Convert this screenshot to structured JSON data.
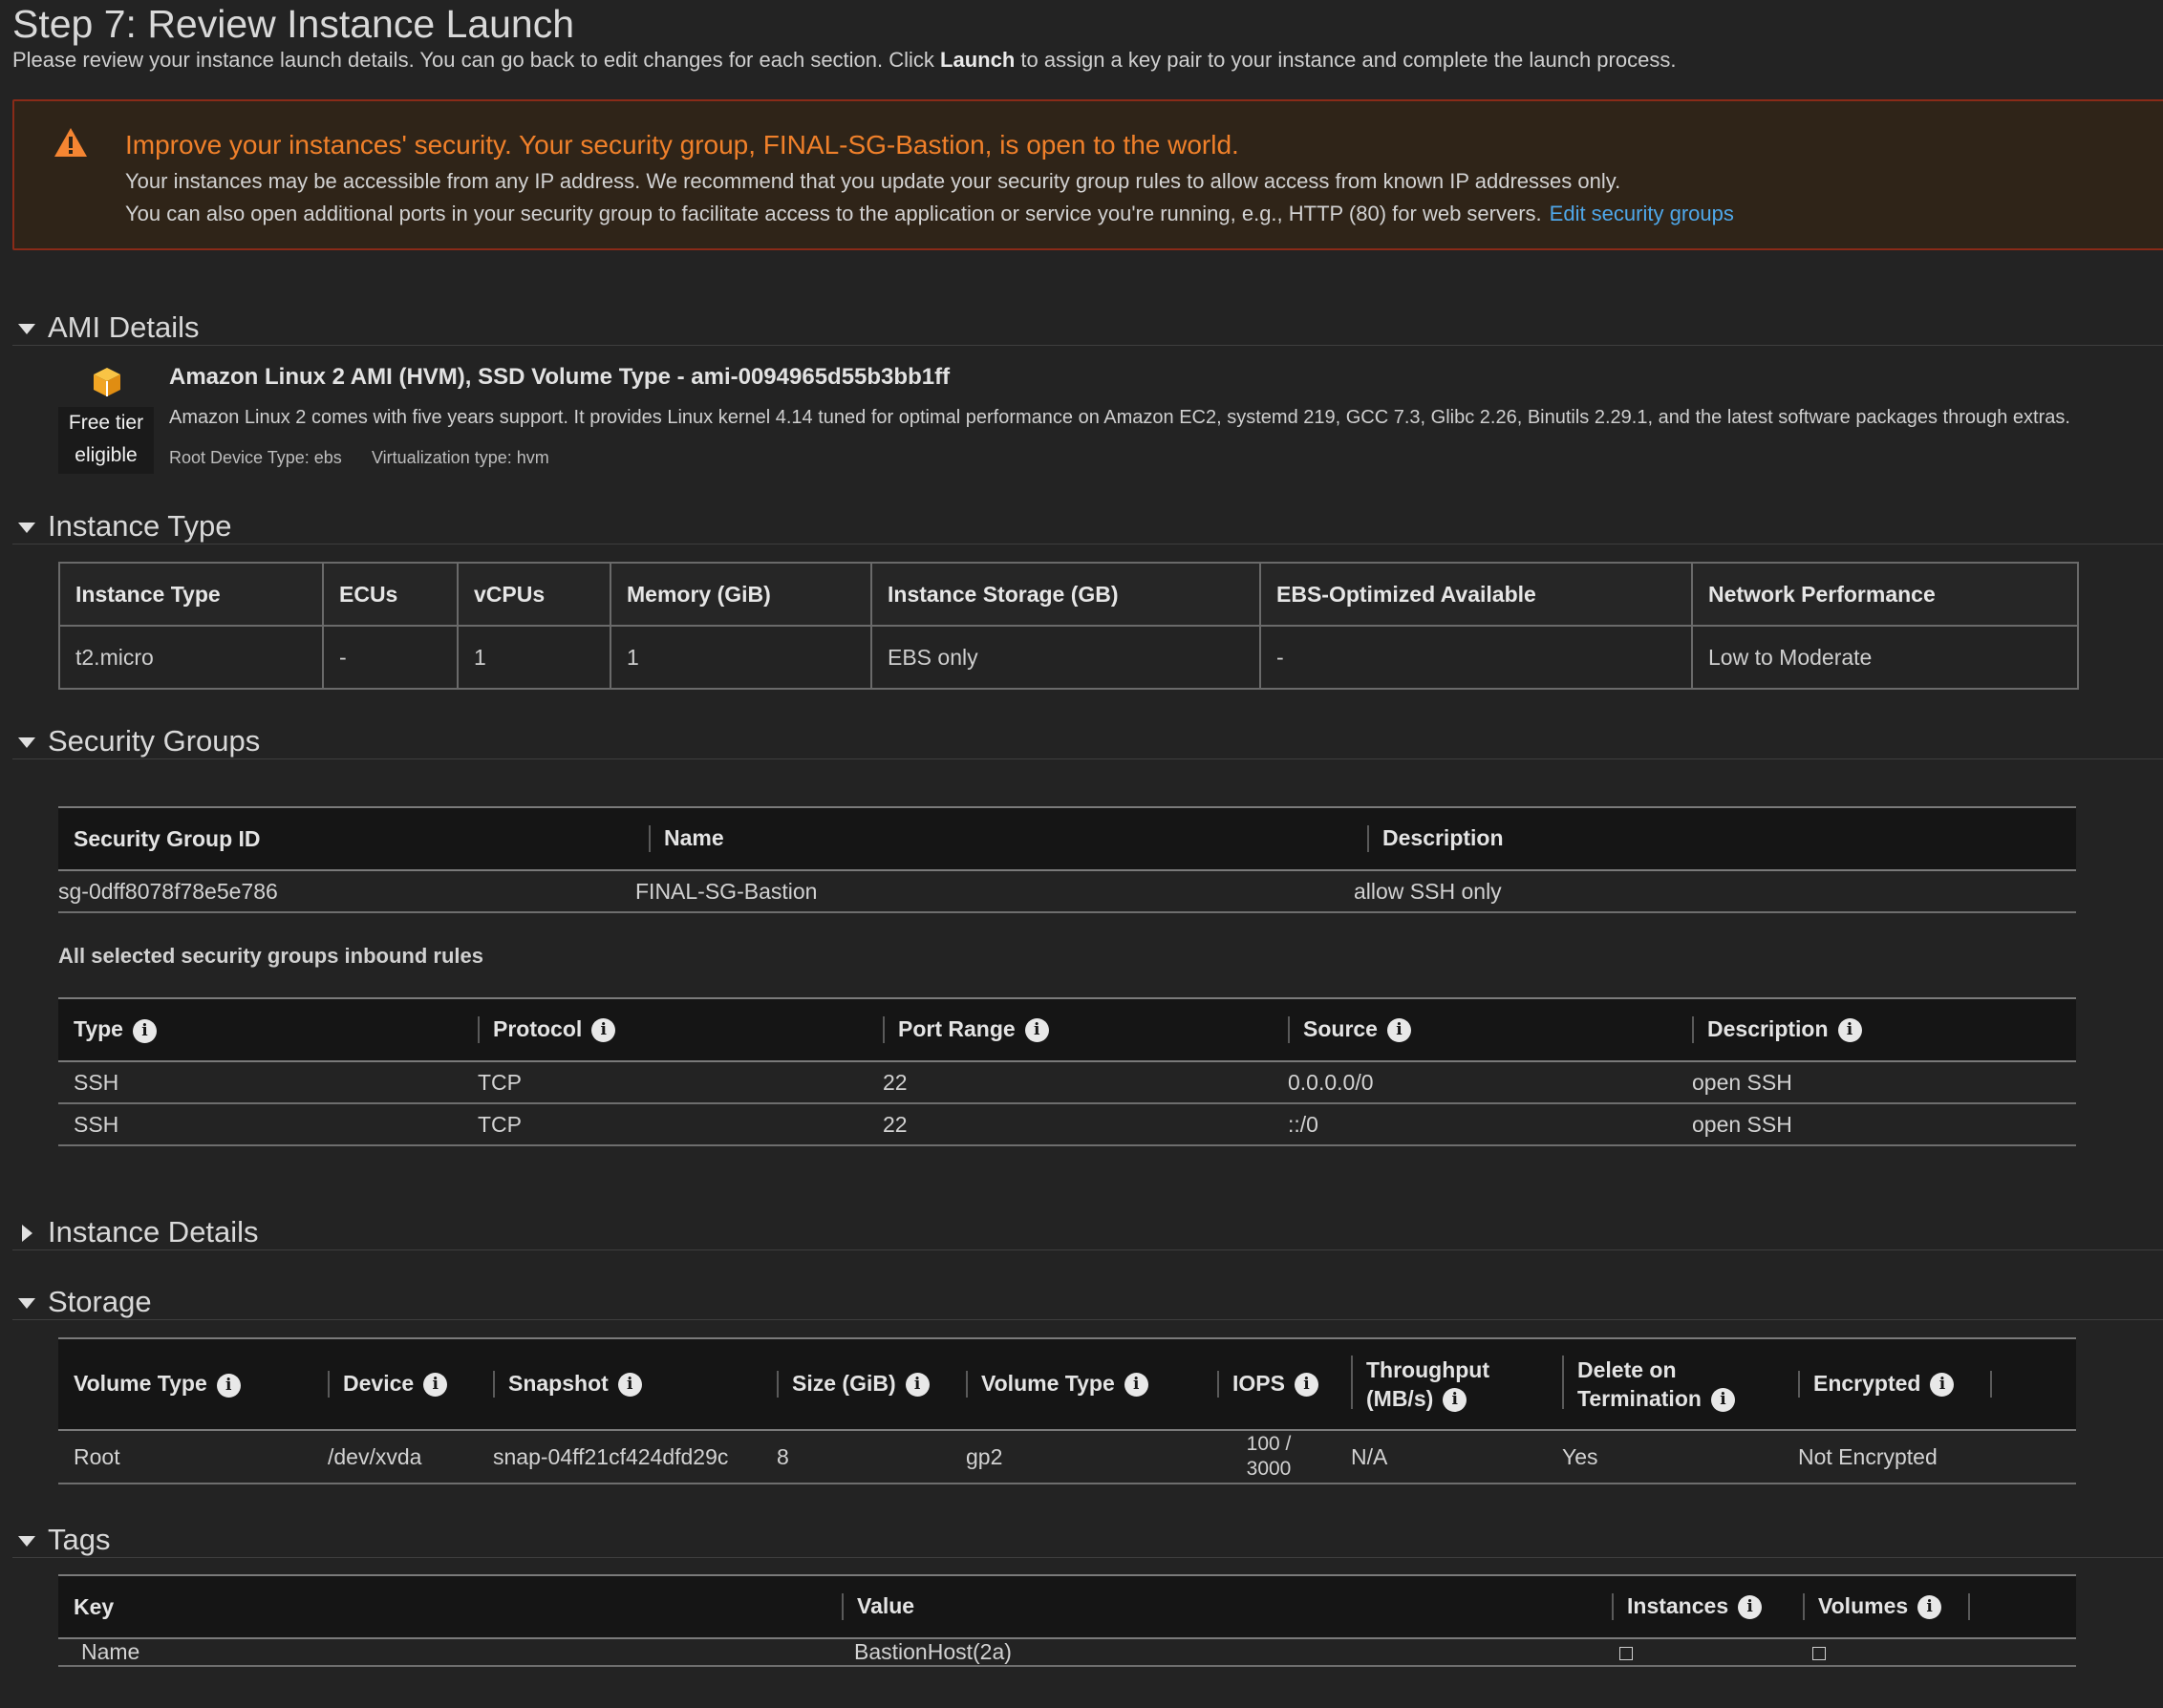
{
  "header": {
    "title": "Step 7: Review Instance Launch",
    "subtitle_pre": "Please review your instance launch details. You can go back to edit changes for each section. Click ",
    "subtitle_bold": "Launch",
    "subtitle_post": " to assign a key pair to your instance and complete the launch process."
  },
  "warning": {
    "title": "Improve your instances' security. Your security group, FINAL-SG-Bastion, is open to the world.",
    "line1": "Your instances may be accessible from any IP address. We recommend that you update your security group rules to allow access from known IP addresses only.",
    "line2": "You can also open additional ports in your security group to facilitate access to the application or service you're running, e.g., HTTP (80) for web servers.",
    "link": "Edit security groups",
    "icon": "warning-triangle-icon",
    "accent": "#f0802a"
  },
  "ami": {
    "section_label": "AMI Details",
    "badge_line1": "Free tier",
    "badge_line2": "eligible",
    "title": "Amazon Linux 2 AMI (HVM), SSD Volume Type - ami-0094965d55b3bb1ff",
    "description": "Amazon Linux 2 comes with five years support. It provides Linux kernel 4.14 tuned for optimal performance on Amazon EC2, systemd 219, GCC 7.3, Glibc 2.26, Binutils 2.29.1, and the latest software packages through extras.",
    "root_device": "Root Device Type: ebs",
    "virtualization": "Virtualization type: hvm"
  },
  "instance_type": {
    "section_label": "Instance Type",
    "headers": [
      "Instance Type",
      "ECUs",
      "vCPUs",
      "Memory (GiB)",
      "Instance Storage (GB)",
      "EBS-Optimized Available",
      "Network Performance"
    ],
    "row": [
      "t2.micro",
      "-",
      "1",
      "1",
      "EBS only",
      "-",
      "Low to Moderate"
    ]
  },
  "security_groups": {
    "section_label": "Security Groups",
    "headers": [
      "Security Group ID",
      "Name",
      "Description"
    ],
    "row": [
      "sg-0dff8078f78e5e786",
      "FINAL-SG-Bastion",
      "allow SSH only"
    ],
    "rules_label": "All selected security groups inbound rules",
    "rule_headers": [
      "Type",
      "Protocol",
      "Port Range",
      "Source",
      "Description"
    ],
    "rules": [
      [
        "SSH",
        "TCP",
        "22",
        "0.0.0.0/0",
        "open SSH"
      ],
      [
        "SSH",
        "TCP",
        "22",
        "::/0",
        "open SSH"
      ]
    ]
  },
  "instance_details": {
    "section_label": "Instance Details"
  },
  "storage": {
    "section_label": "Storage",
    "headers": [
      "Volume Type",
      "Device",
      "Snapshot",
      "Size (GiB)",
      "Volume Type",
      "IOPS",
      "Throughput",
      "(MB/s)",
      "Delete on",
      "Termination",
      "Encrypted"
    ],
    "row": [
      "Root",
      "/dev/xvda",
      "snap-04ff21cf424dfd29c",
      "8",
      "gp2",
      "100 /",
      "3000",
      "N/A",
      "Yes",
      "Not Encrypted"
    ]
  },
  "tags": {
    "section_label": "Tags",
    "headers": [
      "Key",
      "Value",
      "Instances",
      "Volumes"
    ],
    "row": [
      "Name",
      "BastionHost(2a)"
    ]
  }
}
